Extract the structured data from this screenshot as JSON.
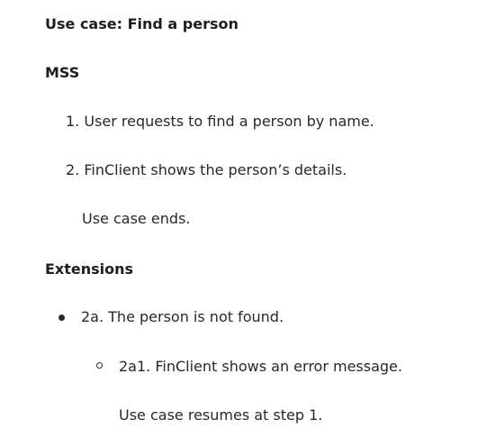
{
  "use_case": {
    "title": "Use case: Find a person"
  },
  "mss": {
    "heading": "MSS",
    "steps": [
      {
        "number": "1.",
        "text": "User requests to find a person by name."
      },
      {
        "number": "2.",
        "text": "FinClient shows the person’s details."
      }
    ],
    "ending": "Use case ends."
  },
  "extensions": {
    "heading": "Extensions",
    "items": [
      {
        "label": "2a. The person is not found.",
        "sub_items": [
          {
            "label": "2a1. FinClient shows an error message.",
            "note": "Use case resumes at step 1."
          }
        ]
      }
    ]
  }
}
